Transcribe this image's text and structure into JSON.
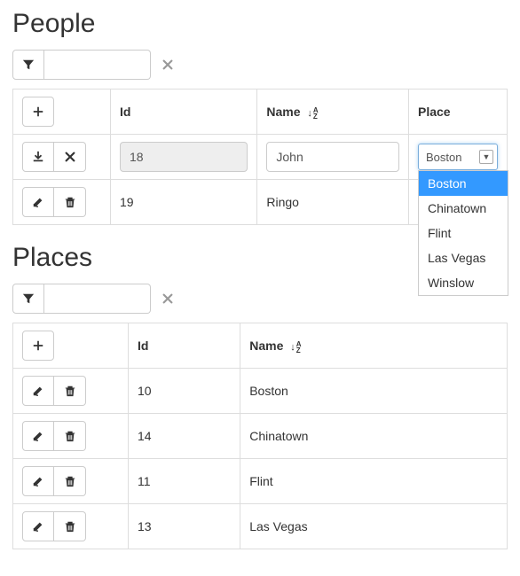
{
  "people": {
    "title": "People",
    "filter_value": "",
    "columns": {
      "id": "Id",
      "name": "Name",
      "place": "Place"
    },
    "sort_column": "Name",
    "edit_row": {
      "id": "18",
      "name": "John",
      "place_selected": "Boston",
      "place_options": [
        "Boston",
        "Chinatown",
        "Flint",
        "Las Vegas",
        "Winslow"
      ]
    },
    "rows": [
      {
        "id": "19",
        "name": "Ringo",
        "place": ""
      }
    ]
  },
  "places": {
    "title": "Places",
    "filter_value": "",
    "columns": {
      "id": "Id",
      "name": "Name"
    },
    "sort_column": "Name",
    "rows": [
      {
        "id": "10",
        "name": "Boston"
      },
      {
        "id": "14",
        "name": "Chinatown"
      },
      {
        "id": "11",
        "name": "Flint"
      },
      {
        "id": "13",
        "name": "Las Vegas"
      }
    ]
  }
}
